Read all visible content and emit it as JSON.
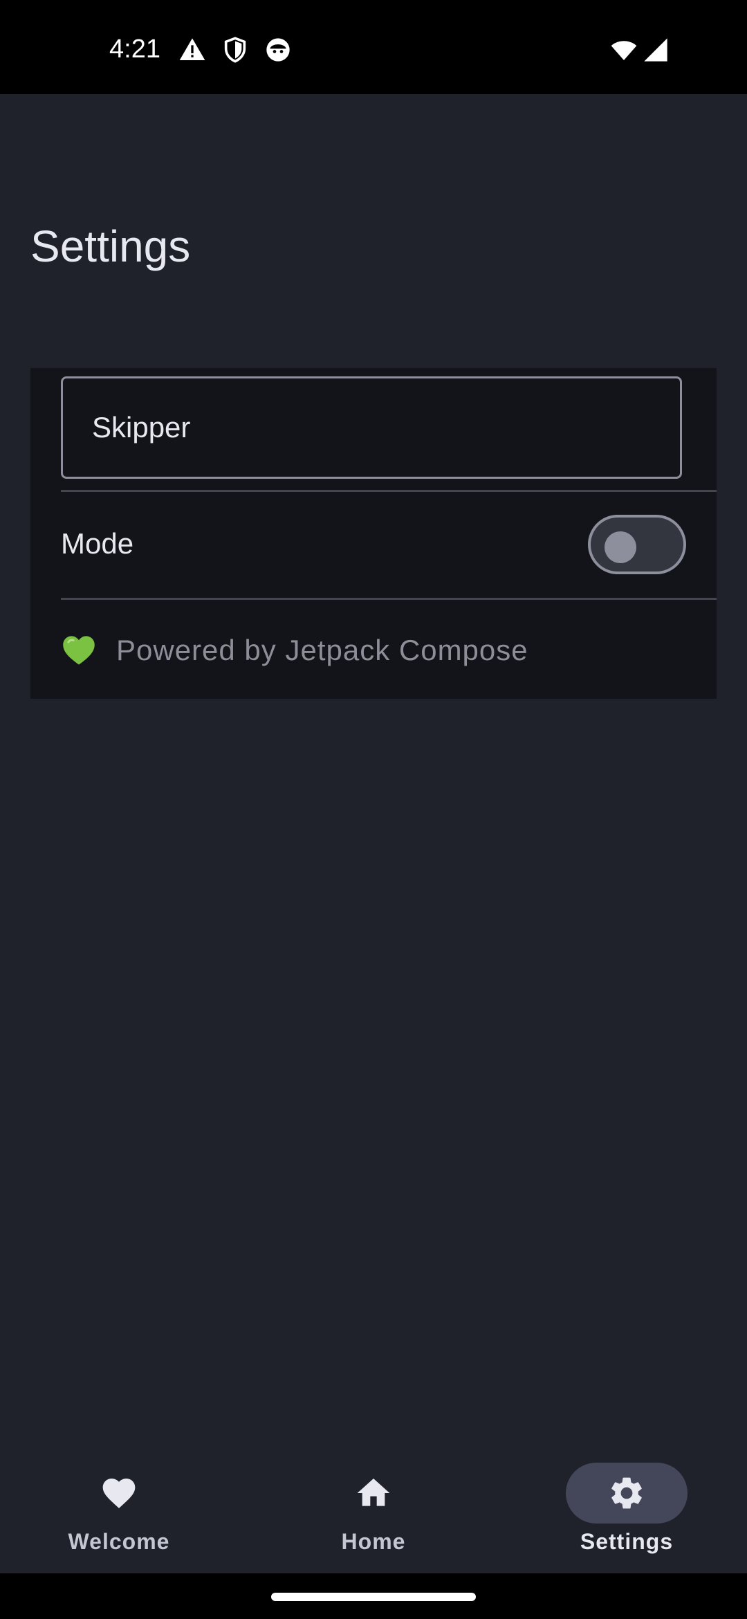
{
  "status_bar": {
    "time": "4:21",
    "icons": [
      "warning-icon",
      "shield-icon",
      "face-icon",
      "wifi-icon",
      "signal-icon"
    ]
  },
  "page": {
    "title": "Settings"
  },
  "settings_card": {
    "name_value": "Skipper",
    "mode_label": "Mode",
    "mode_enabled": false,
    "credit_text": "Powered by Jetpack Compose",
    "credit_icon": "green-heart-icon"
  },
  "bottom_nav": {
    "items": [
      {
        "label": "Welcome",
        "icon": "heart-icon",
        "active": false
      },
      {
        "label": "Home",
        "icon": "home-icon",
        "active": false
      },
      {
        "label": "Settings",
        "icon": "gear-icon",
        "active": true
      }
    ]
  },
  "colors": {
    "background": "#1f212b",
    "card": "#13141a",
    "active_indicator": "#434759",
    "heart_green": "#7cc242"
  }
}
